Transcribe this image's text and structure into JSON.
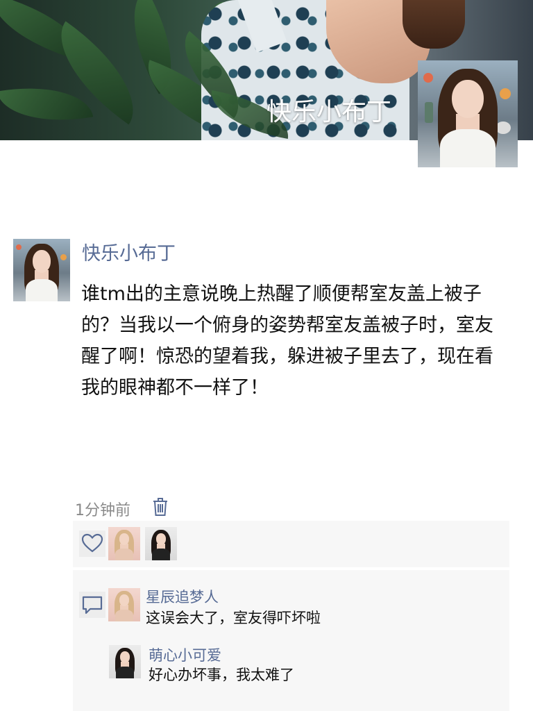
{
  "cover": {
    "owner_name": "快乐小布丁"
  },
  "post": {
    "author_name": "快乐小布丁",
    "text": "谁tm出的主意说晚上热醒了顺便帮室友盖上被子的？当我以一个俯身的姿势帮室友盖被子时，室友醒了啊！惊恐的望着我，躲进被子里去了，现在看我的眼神都不一样了！",
    "time": "1分钟前"
  },
  "likes": {
    "icon": "heart-icon",
    "avatars": [
      "blonde-woman-avatar",
      "dark-hair-woman-avatar"
    ]
  },
  "comments": [
    {
      "name": "星辰追梦人",
      "text": "这误会大了，室友得吓坏啦"
    },
    {
      "name": "萌心小可爱",
      "text": "好心办坏事，我太难了"
    }
  ],
  "colors": {
    "link_blue": "#576b95",
    "text": "#111111",
    "meta_gray": "#8a8a8a",
    "panel_bg": "#f7f7f7"
  }
}
